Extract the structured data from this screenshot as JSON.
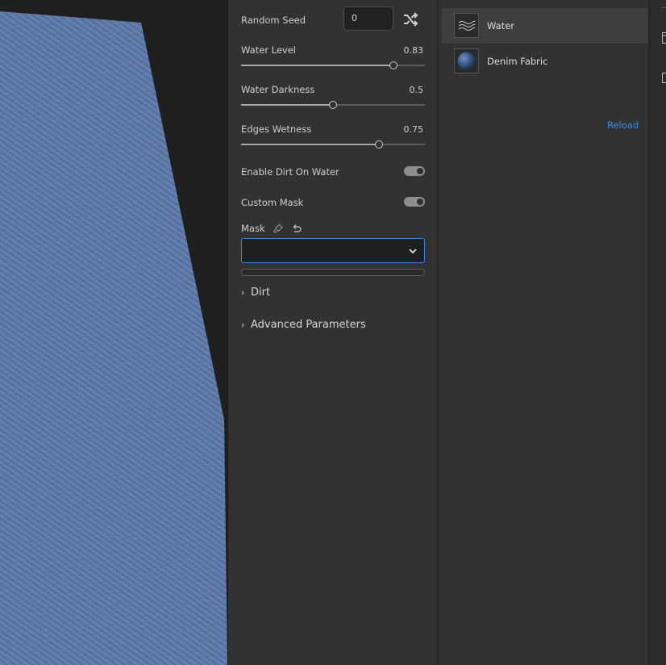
{
  "properties": {
    "random_seed": {
      "label": "Random Seed",
      "value": "0"
    },
    "sliders": [
      {
        "label": "Water Level",
        "value_text": "0.83",
        "value": 0.83
      },
      {
        "label": "Water Darkness",
        "value_text": "0.5",
        "value": 0.5
      },
      {
        "label": "Edges Wetness",
        "value_text": "0.75",
        "value": 0.75
      }
    ],
    "toggles": [
      {
        "label": "Enable Dirt On Water",
        "on": true
      },
      {
        "label": "Custom Mask",
        "on": true
      }
    ],
    "mask": {
      "label": "Mask",
      "selected": ""
    },
    "sections": [
      {
        "label": "Dirt",
        "expanded": false
      },
      {
        "label": "Advanced Parameters",
        "expanded": false
      }
    ]
  },
  "layers": {
    "items": [
      {
        "name": "Water",
        "icon": "water-waves-icon",
        "selected": true
      },
      {
        "name": "Denim Fabric",
        "icon": "sphere-icon",
        "selected": false
      }
    ],
    "reload_label": "Reload"
  },
  "colors": {
    "accent": "#2f86e6",
    "link": "#3b8be8",
    "denim": "#3d5d92",
    "panel": "#323232",
    "viewport_bg": "#1f1f1f"
  }
}
